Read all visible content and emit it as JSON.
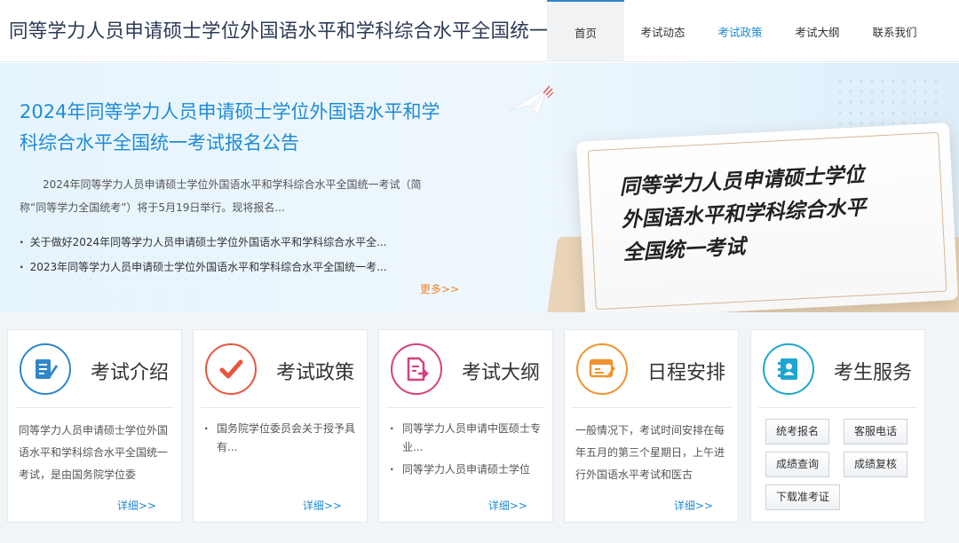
{
  "header": {
    "site_title": "同等学力人员申请硕士学位外国语水平和学科综合水平全国统一考试",
    "nav": [
      "首页",
      "考试动态",
      "考试政策",
      "考试大纲",
      "联系我们"
    ]
  },
  "banner": {
    "title": "2024年同等学力人员申请硕士学位外国语水平和学科综合水平全国统一考试报名公告",
    "summary": "2024年同等学力人员申请硕士学位外国语水平和学科综合水平全国统一考试（简称“同等学力全国统考”）将于5月19日举行。现将报名...",
    "links": [
      "关于做好2024年同等学力人员申请硕士学位外国语水平和学科综合水平全...",
      "2023年同等学力人员申请硕士学位外国语水平和学科综合水平全国统一考..."
    ],
    "more": "更多>>",
    "card_lines": [
      "同等学力人员申请硕士学位",
      "外国语水平和学科综合水平",
      "全国统一考试"
    ]
  },
  "cards": [
    {
      "title": "考试介绍",
      "text": "同等学力人员申请硕士学位外国语水平和学科综合水平全国统一考试，是由国务院学位委",
      "more": "详细>>"
    },
    {
      "title": "考试政策",
      "items": [
        "国务院学位委员会关于授予具有..."
      ],
      "more": "详细>>"
    },
    {
      "title": "考试大纲",
      "items": [
        "同等学力人员申请中医硕士专业...",
        "同等学力人员申请硕士学位"
      ],
      "more": "详细>>"
    },
    {
      "title": "日程安排",
      "text": "一般情况下，考试时间安排在每年五月的第三个星期日，上午进行外国语水平考试和医古",
      "more": "详细>>"
    },
    {
      "title": "考生服务",
      "buttons": [
        "统考报名",
        "客服电话",
        "成绩查询",
        "成绩复核",
        "下载准考证"
      ]
    }
  ],
  "colors": {
    "accent": "#1f8bd6",
    "more_orange": "#f08228",
    "icon_blue": "#2f86c9",
    "icon_red": "#e8553e",
    "icon_pink": "#d6407f",
    "icon_orange": "#f0922f",
    "icon_cyan": "#1da6cf"
  }
}
